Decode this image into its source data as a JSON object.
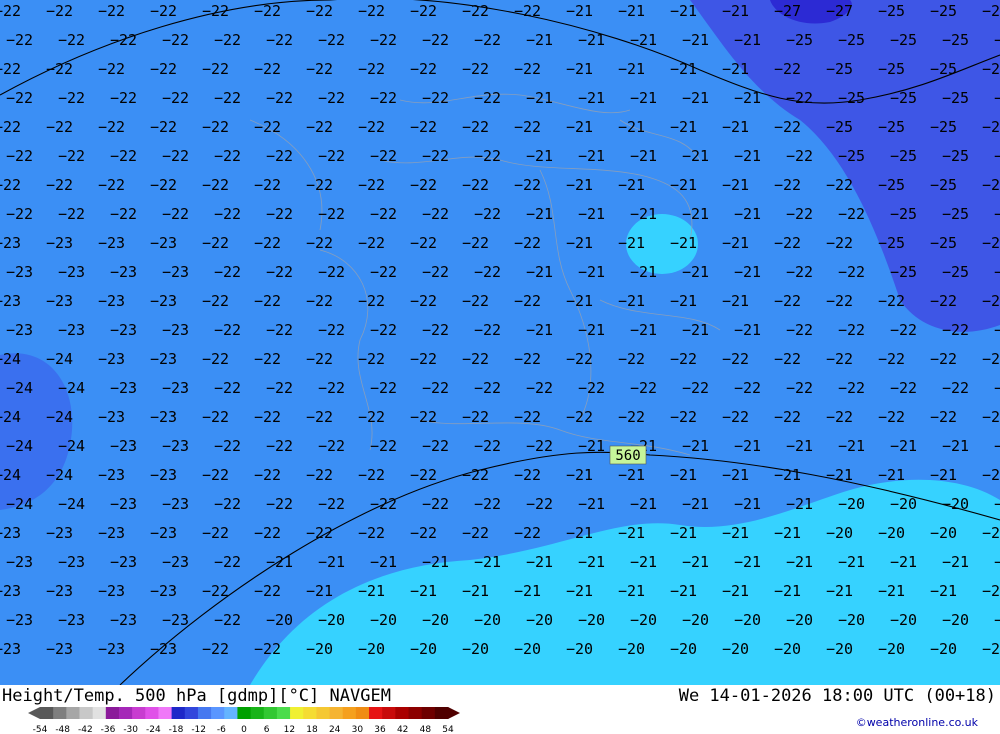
{
  "header": {
    "left": "Height/Temp. 500 hPa [gdmp][°C] NAVGEM",
    "right": "We 14-01-2026 18:00 UTC (00+18)"
  },
  "legend": {
    "ticks": [
      "-54",
      "-48",
      "-42",
      "-36",
      "-30",
      "-24",
      "-18",
      "-12",
      "-6",
      "0",
      "6",
      "12",
      "18",
      "24",
      "30",
      "36",
      "42",
      "48",
      "54"
    ],
    "colors": [
      "#595959",
      "#7f7f7f",
      "#a6a6a6",
      "#c8c8c8",
      "#e1e1e1",
      "#8b1a9a",
      "#a528b8",
      "#c83cd0",
      "#e050e8",
      "#f078f8",
      "#1e28c8",
      "#3246dc",
      "#4678f0",
      "#5a96ff",
      "#64b4ff",
      "#00a000",
      "#19b419",
      "#32c832",
      "#4bdc4b",
      "#f0f032",
      "#f5dc32",
      "#f5c832",
      "#f5b432",
      "#f5a01e",
      "#f08c14",
      "#e61414",
      "#c80a0a",
      "#aa0000",
      "#8c0000",
      "#6e0000",
      "#500000"
    ]
  },
  "map": {
    "contour_label": "560",
    "colors": {
      "band_m20": "#36d2ff",
      "band_m21_m22": "#3b8ff5",
      "band_m23_m24": "#3a70ef",
      "band_m25_m26": "#3e56e6",
      "band_m27": "#2c2ad4"
    }
  },
  "credit": "©weatheronline.co.uk"
}
